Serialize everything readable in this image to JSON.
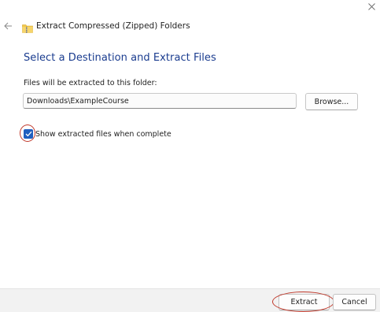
{
  "window": {
    "title": "Extract Compressed (Zipped) Folders",
    "icons": {
      "close": "close-icon",
      "back": "back-arrow-icon",
      "folder": "zip-folder-icon"
    }
  },
  "main": {
    "heading": "Select a Destination and Extract Files",
    "destination_label": "Files will be extracted to this folder:",
    "destination_value": "Downloads\\ExampleCourse",
    "browse_label": "Browse...",
    "show_files_label": "Show extracted files when complete",
    "show_files_checked": true
  },
  "footer": {
    "extract_label": "Extract",
    "cancel_label": "Cancel"
  },
  "colors": {
    "heading": "#1a3c8f",
    "checkbox_fill": "#1f5fbf",
    "annotation_ring": "#c0392b",
    "footer_bg": "#f2f2f2"
  }
}
